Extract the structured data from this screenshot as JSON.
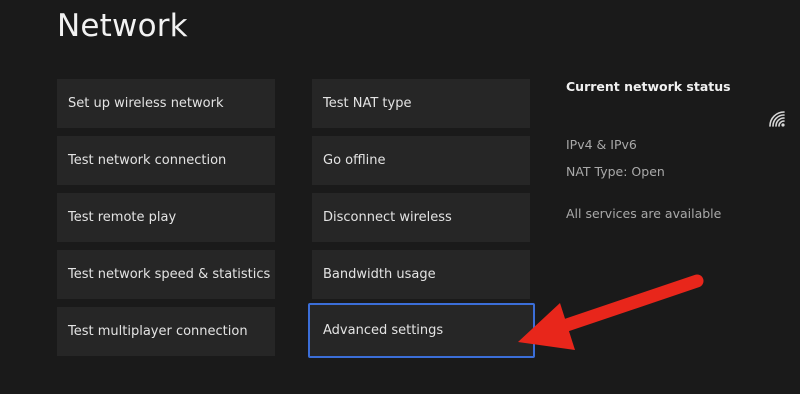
{
  "page": {
    "title": "Network"
  },
  "menu": {
    "column1": [
      {
        "label": "Set up wireless network"
      },
      {
        "label": "Test network connection"
      },
      {
        "label": "Test remote play"
      },
      {
        "label": "Test network speed & statistics"
      },
      {
        "label": "Test multiplayer connection"
      }
    ],
    "column2": [
      {
        "label": "Test NAT type"
      },
      {
        "label": "Go offline"
      },
      {
        "label": "Disconnect wireless"
      },
      {
        "label": "Bandwidth usage"
      },
      {
        "label": "Advanced settings",
        "selected": true
      }
    ]
  },
  "status": {
    "heading": "Current network status",
    "protocol": "IPv4 & IPv6",
    "nat_type": "NAT Type: Open",
    "services": "All services are available",
    "icon": "wifi-icon"
  },
  "colors": {
    "background": "#1a1a1a",
    "tile": "#262626",
    "selection_border": "#3b6ed8",
    "arrow": "#e8261b"
  }
}
